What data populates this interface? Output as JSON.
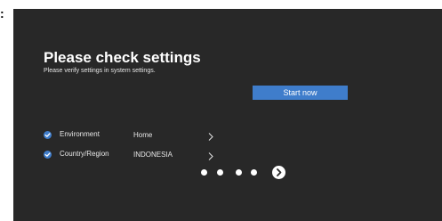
{
  "stray_mark": ":",
  "header": {
    "title": "Please check settings",
    "subtitle": "Please verify settings in system settings."
  },
  "start_button": {
    "label": "Start now"
  },
  "settings": [
    {
      "label": "Environment",
      "value": "Home",
      "checked": true,
      "icon": "check-circle-icon",
      "action_icon": "chevron-right-icon"
    },
    {
      "label": "Country/Region",
      "value": "INDONESIA",
      "checked": true,
      "icon": "check-circle-icon",
      "action_icon": "chevron-right-icon"
    }
  ],
  "pager": {
    "dots": 4,
    "next_icon": "arrow-right-circle-icon"
  },
  "colors": {
    "screen_bg": "#282828",
    "accent": "#3f7dcb",
    "text": "#ffffff"
  }
}
